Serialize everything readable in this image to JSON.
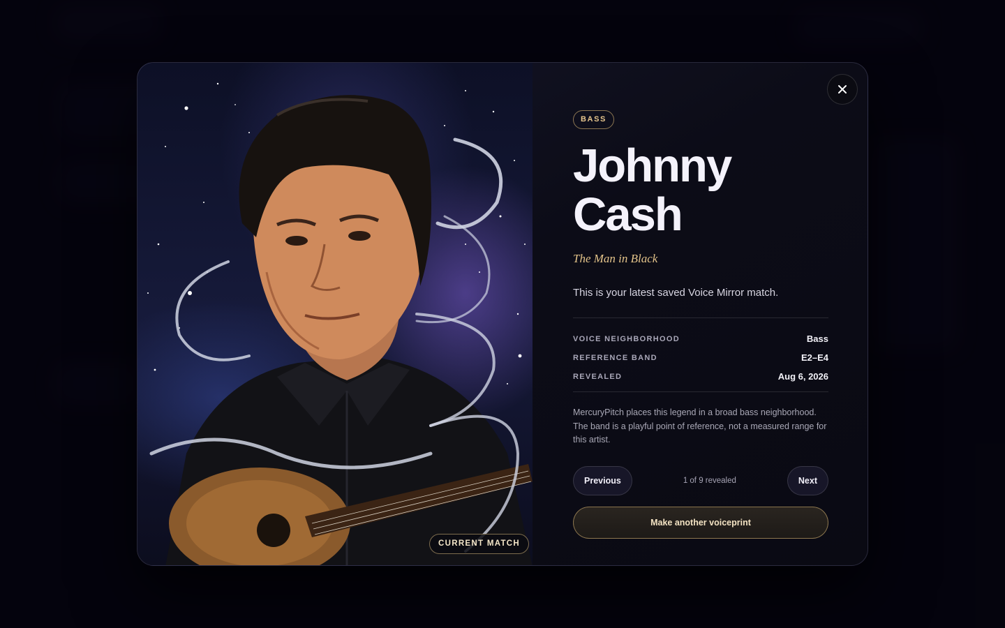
{
  "modal": {
    "badge": "CURRENT MATCH",
    "voice_tag": "BASS",
    "artist_first": "Johnny",
    "artist_last": "Cash",
    "nickname": "The Man in Black",
    "summary": "This is your latest saved Voice Mirror match.",
    "details": [
      {
        "label": "VOICE NEIGHBORHOOD",
        "value": "Bass"
      },
      {
        "label": "REFERENCE BAND",
        "value": "E2–E4"
      },
      {
        "label": "REVEALED",
        "value": "Aug 6, 2026"
      }
    ],
    "description": "MercuryPitch places this legend in a broad bass neighborhood. The band is a playful point of reference, not a measured range for this artist.",
    "previous_label": "Previous",
    "next_label": "Next",
    "counter": "1 of 9 revealed",
    "cta_label": "Make another voiceprint"
  },
  "icons": {
    "close": "close-icon",
    "artwork": "artist-portrait"
  },
  "colors": {
    "accent_gold": "#e6c58d",
    "background": "#07060f",
    "modal_bg": "#0c0c17"
  }
}
